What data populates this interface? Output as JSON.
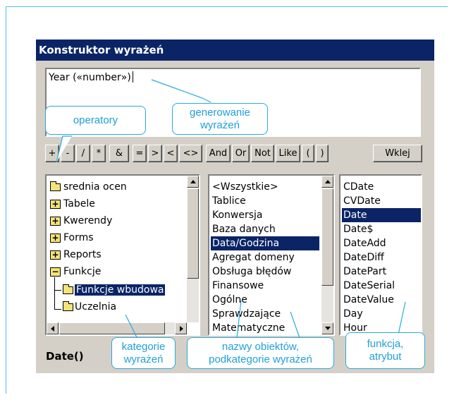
{
  "dialog": {
    "title": "Konstruktor wyrażeń",
    "expression": "Year («number»)",
    "operators": [
      "+",
      "-",
      "/",
      "*",
      "&",
      "=",
      ">",
      "<",
      "<>",
      "And",
      "Or",
      "Not",
      "Like",
      "(",
      ")"
    ],
    "paste_label": "Wklej",
    "status_text": "Date()"
  },
  "tree": {
    "items": [
      "srednia ocen",
      "Tabele",
      "Kwerendy",
      "Forms",
      "Reports",
      "Funkcje",
      "Funkcje wbudowa",
      "Uczelnia"
    ],
    "selected": "Funkcje wbudowa"
  },
  "categories": {
    "items": [
      "<Wszystkie>",
      "Tablice",
      "Konwersja",
      "Baza danych",
      "Data/Godzina",
      "Agregat domeny",
      "Obsługa błędów",
      "Finansowe",
      "Ogólne",
      "Sprawdzające",
      "Matematyczne"
    ],
    "selected": "Data/Godzina"
  },
  "functions": {
    "items": [
      "CDate",
      "CVDate",
      "Date",
      "Date$",
      "DateAdd",
      "DateDiff",
      "DatePart",
      "DateSerial",
      "DateValue",
      "Day",
      "Hour"
    ],
    "selected": "Date"
  },
  "callouts": {
    "operatory": "operatory",
    "generowanie_line1": "generowanie",
    "generowanie_line2": "wyrażeń",
    "kategorie_line1": "kategorie",
    "kategorie_line2": "wyrażeń",
    "nazwy_line1": "nazwy obiektów,",
    "nazwy_line2": "podkategorie wyrażeń",
    "funkcja_line1": "funkcja,",
    "funkcja_line2": "atrybut"
  },
  "colors": {
    "title_bar": "#0a2466",
    "callout_border": "#2aa9df",
    "callout_text": "#1f9fd8",
    "dialog_bg": "#d4d0c8"
  }
}
